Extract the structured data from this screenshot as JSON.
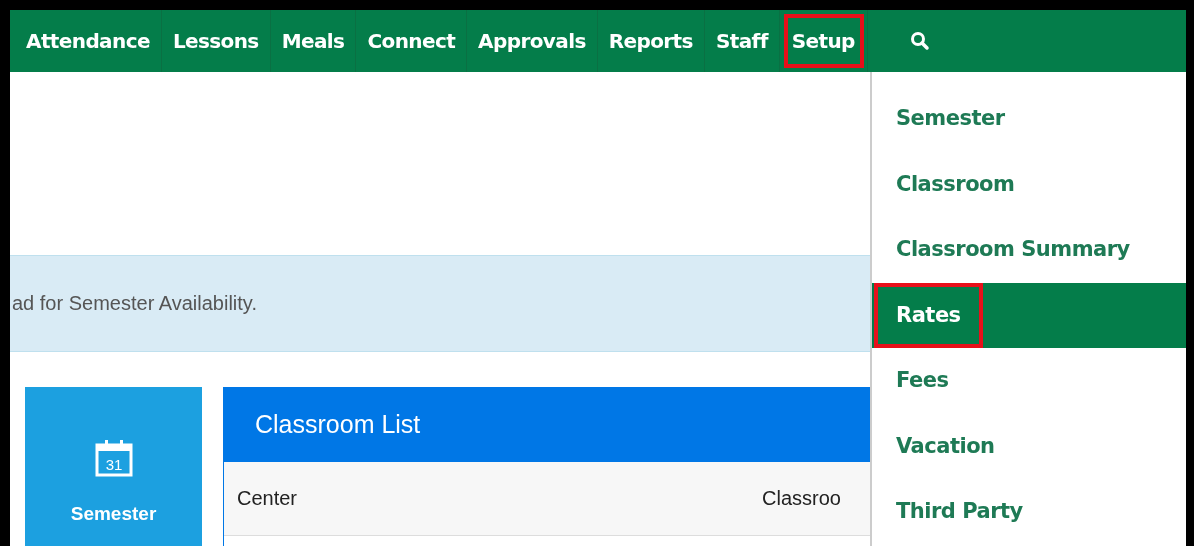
{
  "nav": [
    {
      "label": "Attendance",
      "highlighted": false
    },
    {
      "label": "Lessons",
      "highlighted": false
    },
    {
      "label": "Meals",
      "highlighted": false
    },
    {
      "label": "Connect",
      "highlighted": false
    },
    {
      "label": "Approvals",
      "highlighted": false
    },
    {
      "label": "Reports",
      "highlighted": false
    },
    {
      "label": "Staff",
      "highlighted": false
    },
    {
      "label": "Setup",
      "highlighted": true
    }
  ],
  "alert": "ad for Semester Availability.",
  "tile": {
    "label": "Semester",
    "icon_text": "31"
  },
  "panel": {
    "title": "Classroom List",
    "columns": [
      "Center",
      "Classroo"
    ]
  },
  "dropdown": [
    {
      "label": "Semester",
      "selected": false,
      "highlighted": false
    },
    {
      "label": "Classroom",
      "selected": false,
      "highlighted": false
    },
    {
      "label": "Classroom Summary",
      "selected": false,
      "highlighted": false
    },
    {
      "label": "Rates",
      "selected": true,
      "highlighted": true
    },
    {
      "label": "Fees",
      "selected": false,
      "highlighted": false
    },
    {
      "label": "Vacation",
      "selected": false,
      "highlighted": false
    },
    {
      "label": "Third Party",
      "selected": false,
      "highlighted": false
    }
  ]
}
